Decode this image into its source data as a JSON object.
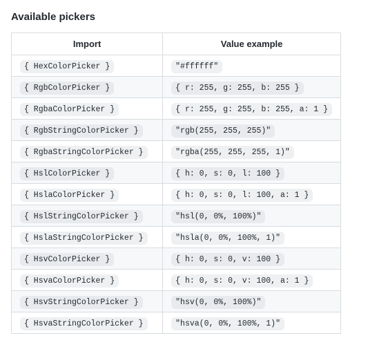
{
  "heading": "Available pickers",
  "columns": {
    "import": "Import",
    "value": "Value example"
  },
  "rows": [
    {
      "import": "{ HexColorPicker }",
      "value": "\"#ffffff\""
    },
    {
      "import": "{ RgbColorPicker }",
      "value": "{ r: 255, g: 255, b: 255 }"
    },
    {
      "import": "{ RgbaColorPicker }",
      "value": "{ r: 255, g: 255, b: 255, a: 1 }"
    },
    {
      "import": "{ RgbStringColorPicker }",
      "value": "\"rgb(255, 255, 255)\""
    },
    {
      "import": "{ RgbaStringColorPicker }",
      "value": "\"rgba(255, 255, 255, 1)\""
    },
    {
      "import": "{ HslColorPicker }",
      "value": "{ h: 0, s: 0, l: 100 }"
    },
    {
      "import": "{ HslaColorPicker }",
      "value": "{ h: 0, s: 0, l: 100, a: 1 }"
    },
    {
      "import": "{ HslStringColorPicker }",
      "value": "\"hsl(0, 0%, 100%)\""
    },
    {
      "import": "{ HslaStringColorPicker }",
      "value": "\"hsla(0, 0%, 100%, 1)\""
    },
    {
      "import": "{ HsvColorPicker }",
      "value": "{ h: 0, s: 0, v: 100 }"
    },
    {
      "import": "{ HsvaColorPicker }",
      "value": "{ h: 0, s: 0, v: 100, a: 1 }"
    },
    {
      "import": "{ HsvStringColorPicker }",
      "value": "\"hsv(0, 0%, 100%)\""
    },
    {
      "import": "{ HsvaStringColorPicker }",
      "value": "\"hsva(0, 0%, 100%, 1)\""
    }
  ]
}
